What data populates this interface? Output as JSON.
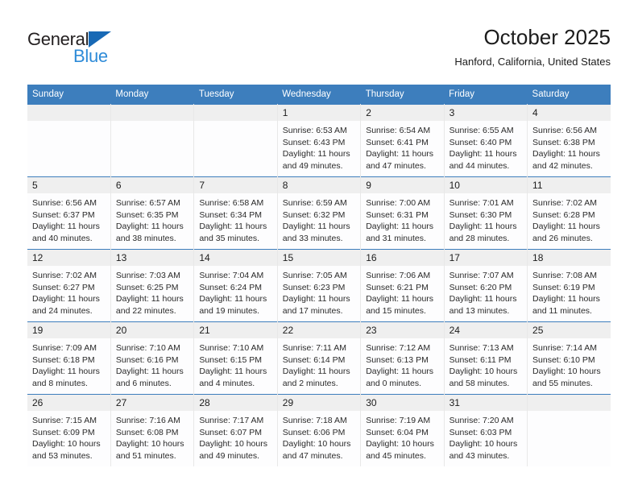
{
  "brand": {
    "name_part1": "General",
    "name_part2": "Blue",
    "triangle_color": "#1869b5",
    "blue_color": "#2e8bd8"
  },
  "header": {
    "month_title": "October 2025",
    "location": "Hanford, California, United States"
  },
  "theme": {
    "header_blue": "#3d7ebd",
    "daynum_band": "#efefef",
    "cell_bg": "#fdfdfe",
    "text": "#1c1c1c"
  },
  "weekday_headers": [
    "Sunday",
    "Monday",
    "Tuesday",
    "Wednesday",
    "Thursday",
    "Friday",
    "Saturday"
  ],
  "labels": {
    "sunrise_prefix": "Sunrise:",
    "sunset_prefix": "Sunset:",
    "daylight_prefix": "Daylight:"
  },
  "weeks": [
    [
      {
        "empty": true
      },
      {
        "empty": true
      },
      {
        "empty": true
      },
      {
        "day": "1",
        "sunrise": "Sunrise: 6:53 AM",
        "sunset": "Sunset: 6:43 PM",
        "daylight_l1": "Daylight: 11 hours",
        "daylight_l2": "and 49 minutes."
      },
      {
        "day": "2",
        "sunrise": "Sunrise: 6:54 AM",
        "sunset": "Sunset: 6:41 PM",
        "daylight_l1": "Daylight: 11 hours",
        "daylight_l2": "and 47 minutes."
      },
      {
        "day": "3",
        "sunrise": "Sunrise: 6:55 AM",
        "sunset": "Sunset: 6:40 PM",
        "daylight_l1": "Daylight: 11 hours",
        "daylight_l2": "and 44 minutes."
      },
      {
        "day": "4",
        "sunrise": "Sunrise: 6:56 AM",
        "sunset": "Sunset: 6:38 PM",
        "daylight_l1": "Daylight: 11 hours",
        "daylight_l2": "and 42 minutes."
      }
    ],
    [
      {
        "day": "5",
        "sunrise": "Sunrise: 6:56 AM",
        "sunset": "Sunset: 6:37 PM",
        "daylight_l1": "Daylight: 11 hours",
        "daylight_l2": "and 40 minutes."
      },
      {
        "day": "6",
        "sunrise": "Sunrise: 6:57 AM",
        "sunset": "Sunset: 6:35 PM",
        "daylight_l1": "Daylight: 11 hours",
        "daylight_l2": "and 38 minutes."
      },
      {
        "day": "7",
        "sunrise": "Sunrise: 6:58 AM",
        "sunset": "Sunset: 6:34 PM",
        "daylight_l1": "Daylight: 11 hours",
        "daylight_l2": "and 35 minutes."
      },
      {
        "day": "8",
        "sunrise": "Sunrise: 6:59 AM",
        "sunset": "Sunset: 6:32 PM",
        "daylight_l1": "Daylight: 11 hours",
        "daylight_l2": "and 33 minutes."
      },
      {
        "day": "9",
        "sunrise": "Sunrise: 7:00 AM",
        "sunset": "Sunset: 6:31 PM",
        "daylight_l1": "Daylight: 11 hours",
        "daylight_l2": "and 31 minutes."
      },
      {
        "day": "10",
        "sunrise": "Sunrise: 7:01 AM",
        "sunset": "Sunset: 6:30 PM",
        "daylight_l1": "Daylight: 11 hours",
        "daylight_l2": "and 28 minutes."
      },
      {
        "day": "11",
        "sunrise": "Sunrise: 7:02 AM",
        "sunset": "Sunset: 6:28 PM",
        "daylight_l1": "Daylight: 11 hours",
        "daylight_l2": "and 26 minutes."
      }
    ],
    [
      {
        "day": "12",
        "sunrise": "Sunrise: 7:02 AM",
        "sunset": "Sunset: 6:27 PM",
        "daylight_l1": "Daylight: 11 hours",
        "daylight_l2": "and 24 minutes."
      },
      {
        "day": "13",
        "sunrise": "Sunrise: 7:03 AM",
        "sunset": "Sunset: 6:25 PM",
        "daylight_l1": "Daylight: 11 hours",
        "daylight_l2": "and 22 minutes."
      },
      {
        "day": "14",
        "sunrise": "Sunrise: 7:04 AM",
        "sunset": "Sunset: 6:24 PM",
        "daylight_l1": "Daylight: 11 hours",
        "daylight_l2": "and 19 minutes."
      },
      {
        "day": "15",
        "sunrise": "Sunrise: 7:05 AM",
        "sunset": "Sunset: 6:23 PM",
        "daylight_l1": "Daylight: 11 hours",
        "daylight_l2": "and 17 minutes."
      },
      {
        "day": "16",
        "sunrise": "Sunrise: 7:06 AM",
        "sunset": "Sunset: 6:21 PM",
        "daylight_l1": "Daylight: 11 hours",
        "daylight_l2": "and 15 minutes."
      },
      {
        "day": "17",
        "sunrise": "Sunrise: 7:07 AM",
        "sunset": "Sunset: 6:20 PM",
        "daylight_l1": "Daylight: 11 hours",
        "daylight_l2": "and 13 minutes."
      },
      {
        "day": "18",
        "sunrise": "Sunrise: 7:08 AM",
        "sunset": "Sunset: 6:19 PM",
        "daylight_l1": "Daylight: 11 hours",
        "daylight_l2": "and 11 minutes."
      }
    ],
    [
      {
        "day": "19",
        "sunrise": "Sunrise: 7:09 AM",
        "sunset": "Sunset: 6:18 PM",
        "daylight_l1": "Daylight: 11 hours",
        "daylight_l2": "and 8 minutes."
      },
      {
        "day": "20",
        "sunrise": "Sunrise: 7:10 AM",
        "sunset": "Sunset: 6:16 PM",
        "daylight_l1": "Daylight: 11 hours",
        "daylight_l2": "and 6 minutes."
      },
      {
        "day": "21",
        "sunrise": "Sunrise: 7:10 AM",
        "sunset": "Sunset: 6:15 PM",
        "daylight_l1": "Daylight: 11 hours",
        "daylight_l2": "and 4 minutes."
      },
      {
        "day": "22",
        "sunrise": "Sunrise: 7:11 AM",
        "sunset": "Sunset: 6:14 PM",
        "daylight_l1": "Daylight: 11 hours",
        "daylight_l2": "and 2 minutes."
      },
      {
        "day": "23",
        "sunrise": "Sunrise: 7:12 AM",
        "sunset": "Sunset: 6:13 PM",
        "daylight_l1": "Daylight: 11 hours",
        "daylight_l2": "and 0 minutes."
      },
      {
        "day": "24",
        "sunrise": "Sunrise: 7:13 AM",
        "sunset": "Sunset: 6:11 PM",
        "daylight_l1": "Daylight: 10 hours",
        "daylight_l2": "and 58 minutes."
      },
      {
        "day": "25",
        "sunrise": "Sunrise: 7:14 AM",
        "sunset": "Sunset: 6:10 PM",
        "daylight_l1": "Daylight: 10 hours",
        "daylight_l2": "and 55 minutes."
      }
    ],
    [
      {
        "day": "26",
        "sunrise": "Sunrise: 7:15 AM",
        "sunset": "Sunset: 6:09 PM",
        "daylight_l1": "Daylight: 10 hours",
        "daylight_l2": "and 53 minutes."
      },
      {
        "day": "27",
        "sunrise": "Sunrise: 7:16 AM",
        "sunset": "Sunset: 6:08 PM",
        "daylight_l1": "Daylight: 10 hours",
        "daylight_l2": "and 51 minutes."
      },
      {
        "day": "28",
        "sunrise": "Sunrise: 7:17 AM",
        "sunset": "Sunset: 6:07 PM",
        "daylight_l1": "Daylight: 10 hours",
        "daylight_l2": "and 49 minutes."
      },
      {
        "day": "29",
        "sunrise": "Sunrise: 7:18 AM",
        "sunset": "Sunset: 6:06 PM",
        "daylight_l1": "Daylight: 10 hours",
        "daylight_l2": "and 47 minutes."
      },
      {
        "day": "30",
        "sunrise": "Sunrise: 7:19 AM",
        "sunset": "Sunset: 6:04 PM",
        "daylight_l1": "Daylight: 10 hours",
        "daylight_l2": "and 45 minutes."
      },
      {
        "day": "31",
        "sunrise": "Sunrise: 7:20 AM",
        "sunset": "Sunset: 6:03 PM",
        "daylight_l1": "Daylight: 10 hours",
        "daylight_l2": "and 43 minutes."
      },
      {
        "empty": true
      }
    ]
  ]
}
